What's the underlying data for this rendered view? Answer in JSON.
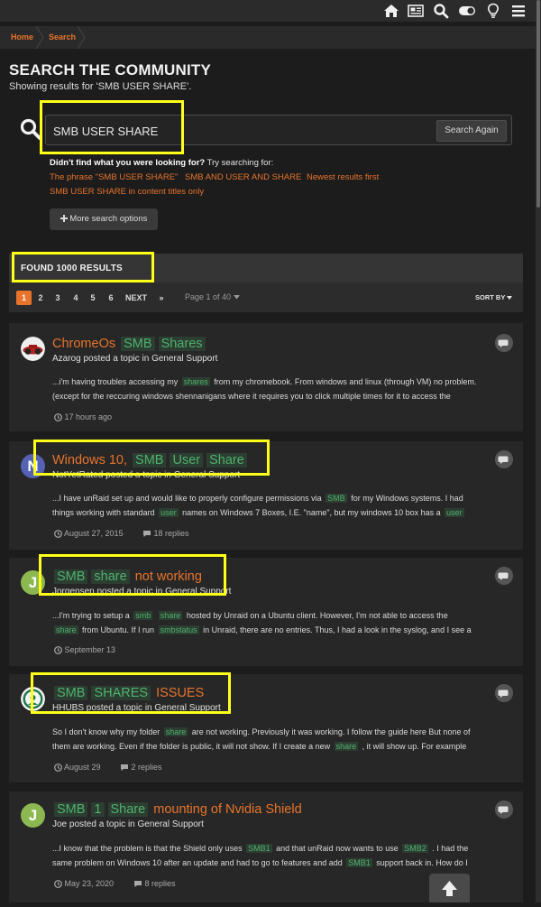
{
  "breadcrumb": {
    "home": "Home",
    "current": "Search"
  },
  "page": {
    "title": "SEARCH THE COMMUNITY",
    "subtitle": "Showing results for 'SMB USER SHARE'."
  },
  "search": {
    "value": "SMB USER SHARE",
    "button": "Search Again"
  },
  "suggestions": {
    "prompt_bold": "Didn't find what you were looking for?",
    "prompt_rest": " Try searching for:",
    "items": [
      "The phrase \"SMB USER SHARE\"",
      "SMB AND USER AND SHARE",
      "Newest results first",
      "SMB USER SHARE in content titles only"
    ]
  },
  "more_options": "More search options",
  "results": {
    "found_label": "FOUND 1000 RESULTS",
    "pages": [
      "1",
      "2",
      "3",
      "4",
      "5",
      "6"
    ],
    "next": "NEXT",
    "last": "»",
    "page_info": "Page 1 of 40",
    "sort": "SORT BY"
  },
  "items": [
    {
      "title_parts": [
        "ChromeOs",
        "SMB",
        "Shares"
      ],
      "meta": "Azarog posted a topic in General Support",
      "line1": [
        "...i'm having troubles accessing my ",
        "shares",
        " from my chromebook. From windows and linux (through VM) no problem."
      ],
      "line2": "(except for the reccuring windows shennanigans where it requires you to click multiple times for it to access the",
      "time": "17 hours ago"
    },
    {
      "title_parts": [
        "Windows 10,",
        "SMB",
        "User",
        "Share"
      ],
      "meta": "NotYetRated posted a topic in General Support",
      "avatar": "N",
      "line1": [
        "...I have unRaid set up and would like to properly configure permissions via ",
        "SMB",
        " for my Windows systems. I had"
      ],
      "line2": [
        "things working with standard ",
        "user",
        " names on Windows 7 Boxes, I.E. \"name\", but my windows 10 box has a ",
        "user"
      ],
      "time": "August 27, 2015",
      "replies": "18 replies"
    },
    {
      "title_parts": [
        "SMB",
        "share",
        "not working"
      ],
      "meta": "Jorgensen posted a topic in General Support",
      "avatar": "J",
      "line1": [
        "...I'm trying to setup a ",
        "smb",
        " ",
        "share",
        " hosted by Unraid on a Ubuntu client. However, I'm not able to access the"
      ],
      "line2": [
        "share",
        " from Ubuntu. If I run ",
        "smbstatus",
        " in Unraid, there are no entries. Thus, I had a look in the syslog, and I see a"
      ],
      "time": "September 13"
    },
    {
      "title_parts": [
        "SMB",
        "SHARES",
        "ISSUES"
      ],
      "meta": "HHUBS posted a topic in General Support",
      "line1": [
        "So I don't know why my folder ",
        "share",
        " are not working. Previously it was working. I follow the guide here But none of"
      ],
      "line2": [
        "them are working. Even if the folder is public, it will not show. If I create a new ",
        "share",
        " , it will show up. For example"
      ],
      "time": "August 29",
      "replies": "2 replies"
    },
    {
      "title_parts": [
        "SMB",
        "1",
        "Share",
        "mounting of Nvidia Shield"
      ],
      "meta": "Joe posted a topic in General Support",
      "avatar": "J",
      "line1": [
        "...I know that the problem is that the Shield only uses ",
        "SMB1",
        " and that unRaid now wants to use ",
        "SMB2",
        " . I had the"
      ],
      "line2": [
        "same problem on Windows 10 after an update and had to go to features and add ",
        "SMB1",
        " support back in. How do I"
      ],
      "time": "May 23, 2020",
      "replies": "8 replies"
    }
  ],
  "colors": {
    "accent": "#e8742c",
    "keyword": "#4fb26e",
    "highlight_box": "#ffff1a",
    "avatar_blue": "#5562b4",
    "avatar_green": "#8db851"
  },
  "icons": [
    "home-icon",
    "news-icon",
    "search-icon",
    "toggle-icon",
    "bulb-icon",
    "menu-icon",
    "chat-icon",
    "clock-icon",
    "comment-icon",
    "plus-icon",
    "caret-down-icon",
    "arrow-up-icon"
  ]
}
